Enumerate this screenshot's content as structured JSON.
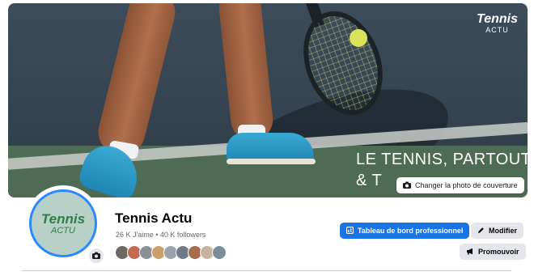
{
  "cover": {
    "logo_line1": "Tennis",
    "logo_line2": "ACTU",
    "slogan_line1": "LE TENNIS, PARTOUT",
    "slogan_line2": "& T",
    "change_cover_label": "Changer la photo de couverture",
    "change_cover_icon": "camera-icon"
  },
  "profile": {
    "avatar_line1": "Tennis",
    "avatar_line2": "ACTU",
    "avatar_camera_icon": "camera-icon",
    "name": "Tennis Actu",
    "stats": "26 K J'aime • 40 K followers",
    "friend_colors": [
      "#6d6a66",
      "#c46a4e",
      "#8b8f96",
      "#c9a06b",
      "#9aa1aa",
      "#6e7b86",
      "#a86d4d",
      "#c8b3a0",
      "#7d8c99"
    ]
  },
  "actions": {
    "dashboard_label": "Tableau de bord professionnel",
    "dashboard_icon": "dashboard-icon",
    "edit_label": "Modifier",
    "edit_icon": "pencil-icon",
    "promote_label": "Promouvoir",
    "promote_icon": "megaphone-icon"
  },
  "colors": {
    "accent": "#1b74e4",
    "avatar_bg": "#b7d1c8",
    "logo_green": "#2e7d46"
  }
}
